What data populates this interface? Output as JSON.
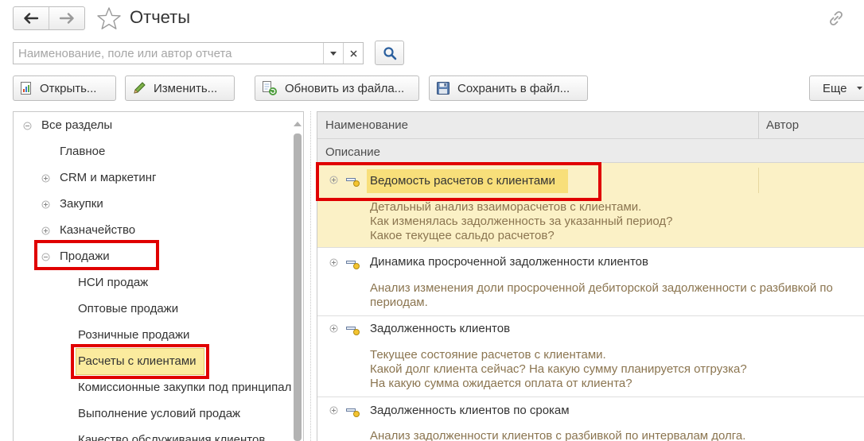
{
  "window": {
    "title": "Отчеты"
  },
  "search": {
    "placeholder": "Наименование, поле или автор отчета",
    "value": ""
  },
  "toolbar": {
    "open_label": "Открыть...",
    "edit_label": "Изменить...",
    "update_label": "Обновить из файла...",
    "save_label": "Сохранить в файл...",
    "more_label": "Еще"
  },
  "tree": {
    "items": [
      {
        "label": "Все разделы",
        "level": 0,
        "state": "expanded"
      },
      {
        "label": "Главное",
        "level": 1,
        "state": "leaf"
      },
      {
        "label": "CRM и маркетинг",
        "level": 1,
        "state": "collapsed"
      },
      {
        "label": "Закупки",
        "level": 1,
        "state": "collapsed"
      },
      {
        "label": "Казначейство",
        "level": 1,
        "state": "collapsed"
      },
      {
        "label": "Продажи",
        "level": 1,
        "state": "expanded"
      },
      {
        "label": "НСИ продаж",
        "level": 2,
        "state": "leaf"
      },
      {
        "label": "Оптовые продажи",
        "level": 2,
        "state": "leaf"
      },
      {
        "label": "Розничные продажи",
        "level": 2,
        "state": "leaf"
      },
      {
        "label": "Расчеты с клиентами",
        "level": 2,
        "state": "selected"
      },
      {
        "label": "Комиссионные закупки под принципал",
        "level": 2,
        "state": "leaf"
      },
      {
        "label": "Выполнение условий продаж",
        "level": 2,
        "state": "leaf"
      },
      {
        "label": "Качество обслуживания клиентов",
        "level": 2,
        "state": "leaf"
      }
    ]
  },
  "list": {
    "columns": {
      "name": "Наименование",
      "author": "Автор",
      "description": "Описание"
    },
    "reports": [
      {
        "title": "Ведомость расчетов с клиентами",
        "description": [
          "Детальный анализ взаиморасчетов с клиентами.",
          "Как изменялась задолженность за указанный период?",
          "Какое текущее сальдо расчетов?"
        ],
        "selected": true
      },
      {
        "title": "Динамика просроченной задолженности клиентов",
        "description": [
          "Анализ изменения доли просроченной дебиторской задолженности с разбивкой по",
          "периодам."
        ],
        "selected": false
      },
      {
        "title": "Задолженность клиентов",
        "description": [
          "Текущее состояние расчетов с клиентами.",
          "Какой долг клиента сейчас? На какую сумму планируется отгрузка?",
          "На какую сумма ожидается оплата от клиента?"
        ],
        "selected": false
      },
      {
        "title": "Задолженность клиентов по срокам",
        "description": [
          "Анализ задолженности клиентов с разбивкой по интервалам долга."
        ],
        "selected": false
      }
    ]
  },
  "colors": {
    "selection": "#fbeb9e",
    "row_selected": "#fbf1c6",
    "highlight": "#e00000",
    "description_text": "#8b7550"
  },
  "icons": {
    "back": "arrow-left-icon",
    "forward": "arrow-right-icon",
    "favorite": "star-icon",
    "link": "link-icon",
    "search": "magnifier-icon",
    "report": "report-icon"
  }
}
